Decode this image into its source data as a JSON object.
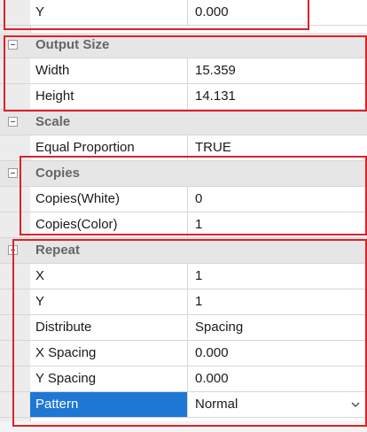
{
  "rows": {
    "y_top": {
      "label": "Y",
      "value": "0.000"
    },
    "output_size": {
      "title": "Output Size"
    },
    "width": {
      "label": "Width",
      "value": "15.359"
    },
    "height": {
      "label": "Height",
      "value": "14.131"
    },
    "scale": {
      "title": "Scale"
    },
    "equal_proportion": {
      "label": "Equal Proportion",
      "value": "TRUE"
    },
    "copies": {
      "title": "Copies"
    },
    "copies_white": {
      "label": "Copies(White)",
      "value": "0"
    },
    "copies_color": {
      "label": "Copies(Color)",
      "value": "1"
    },
    "repeat": {
      "title": "Repeat"
    },
    "x": {
      "label": "X",
      "value": "1"
    },
    "y": {
      "label": "Y",
      "value": "1"
    },
    "distribute": {
      "label": "Distribute",
      "value": "Spacing"
    },
    "x_spacing": {
      "label": "X Spacing",
      "value": "0.000"
    },
    "y_spacing": {
      "label": "Y Spacing",
      "value": "0.000"
    },
    "pattern": {
      "label": "Pattern",
      "value": "Normal"
    }
  },
  "colors": {
    "highlight_box": "#d9232d",
    "selected_row": "#1e77d4",
    "category_bg": "#e6e6e6"
  },
  "icons": {
    "collapse": "minus-box",
    "dropdown": "chevron-down"
  }
}
